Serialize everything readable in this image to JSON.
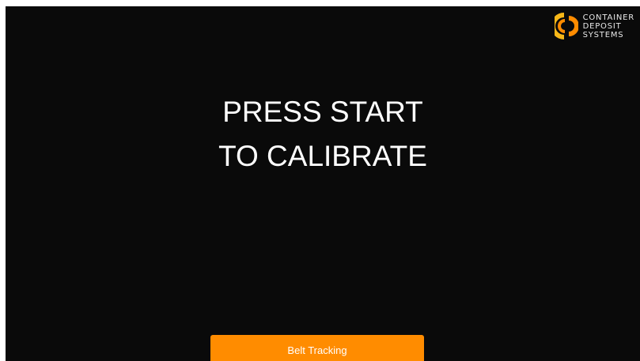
{
  "logo": {
    "icon": "container-deposit-logo-icon",
    "lines": [
      "CONTAINER",
      "DEPOSIT",
      "SYSTEMS"
    ]
  },
  "prompt": {
    "line1": "PRESS START",
    "line2": "TO CALIBRATE"
  },
  "button": {
    "label": "Belt Tracking"
  },
  "colors": {
    "background": "#0a0a0a",
    "accent": "#ff8c00",
    "logo_yellow": "#f7b718",
    "text": "#ffffff"
  }
}
